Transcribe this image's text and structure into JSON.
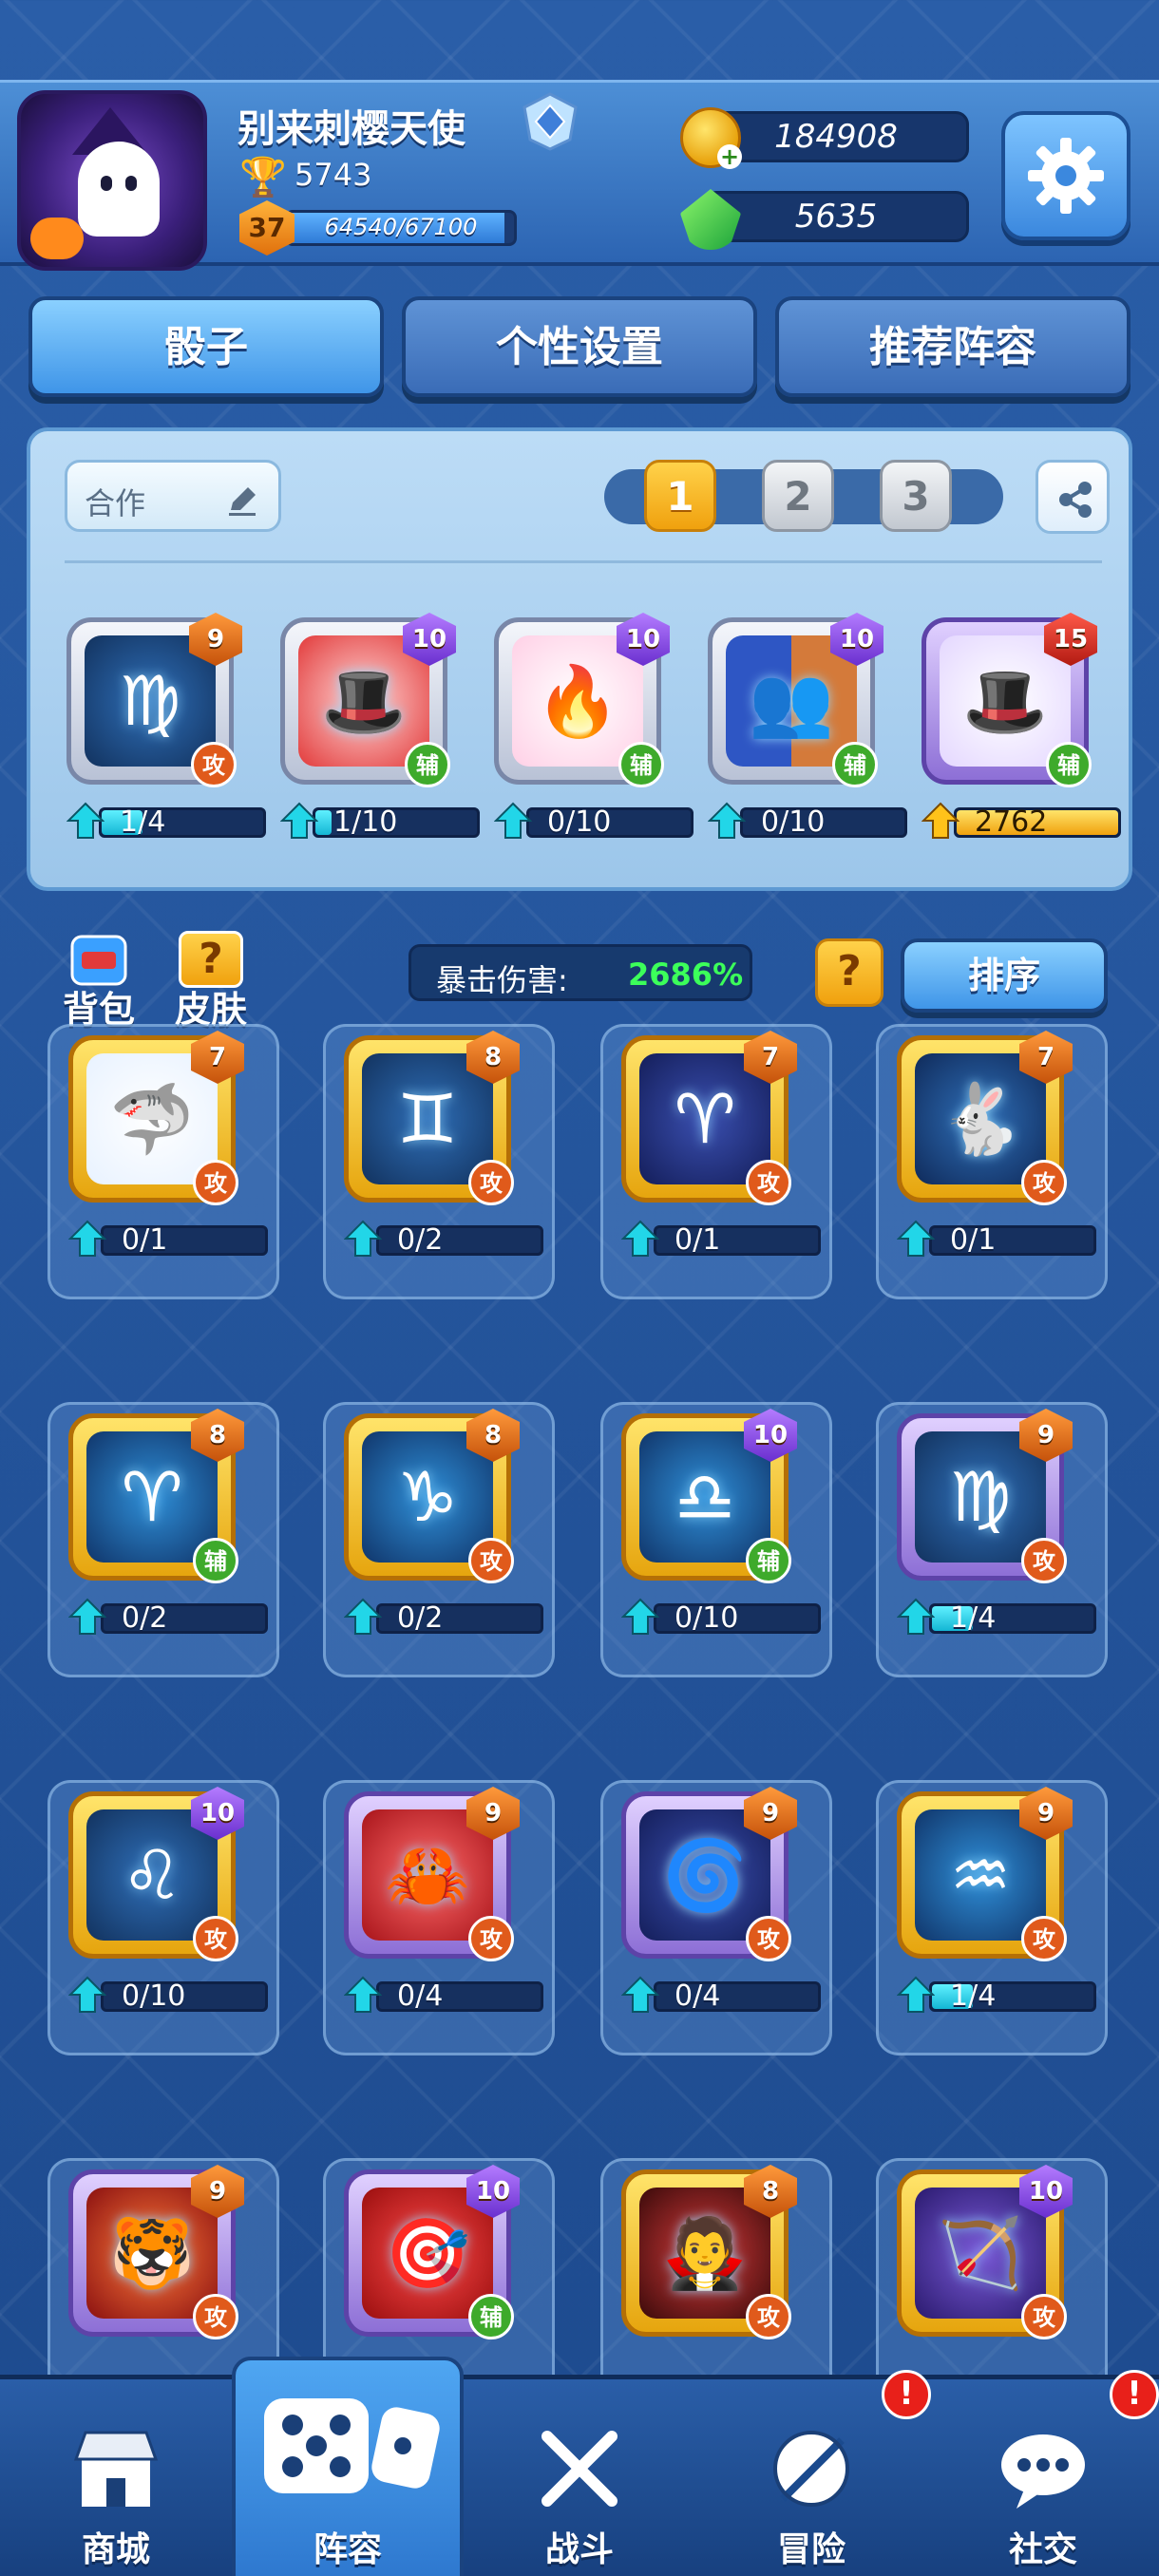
{
  "player": {
    "name": "别来刺樱天使",
    "trophies": "5743",
    "level": "37",
    "xp_text": "64540/67100"
  },
  "currency": {
    "coins": "184908",
    "gems": "5635"
  },
  "tabs": [
    {
      "label": "骰子"
    },
    {
      "label": "个性设置"
    },
    {
      "label": "推荐阵容"
    }
  ],
  "deck": {
    "name": "合作",
    "pages": [
      "1",
      "2",
      "3"
    ],
    "active_page": "1",
    "cards": [
      {
        "level": "9",
        "role": "攻",
        "progress": "1/4",
        "fill": 0.25
      },
      {
        "level": "10",
        "role": "辅",
        "progress": "1/10",
        "fill": 0.1
      },
      {
        "level": "10",
        "role": "辅",
        "progress": "0/10",
        "fill": 0
      },
      {
        "level": "10",
        "role": "辅",
        "progress": "0/10",
        "fill": 0
      },
      {
        "level": "15",
        "role": "辅",
        "progress": "2762",
        "fill": 1
      }
    ]
  },
  "toolbar": {
    "bag_label": "背包",
    "skin_label": "皮肤",
    "crit_label": "暴击伤害:",
    "crit_value": "2686%",
    "help_label": "?",
    "sort_label": "排序"
  },
  "collection": [
    {
      "level": "7",
      "role": "攻",
      "progress": "0/1",
      "fill": 0
    },
    {
      "level": "8",
      "role": "攻",
      "progress": "0/2",
      "fill": 0
    },
    {
      "level": "7",
      "role": "攻",
      "progress": "0/1",
      "fill": 0
    },
    {
      "level": "7",
      "role": "攻",
      "progress": "0/1",
      "fill": 0
    },
    {
      "level": "8",
      "role": "辅",
      "progress": "0/2",
      "fill": 0
    },
    {
      "level": "8",
      "role": "攻",
      "progress": "0/2",
      "fill": 0
    },
    {
      "level": "10",
      "role": "辅",
      "progress": "0/10",
      "fill": 0
    },
    {
      "level": "9",
      "role": "攻",
      "progress": "1/4",
      "fill": 0.25
    },
    {
      "level": "10",
      "role": "攻",
      "progress": "0/10",
      "fill": 0
    },
    {
      "level": "9",
      "role": "攻",
      "progress": "0/4",
      "fill": 0
    },
    {
      "level": "9",
      "role": "攻",
      "progress": "0/4",
      "fill": 0
    },
    {
      "level": "9",
      "role": "攻",
      "progress": "1/4",
      "fill": 0.25
    },
    {
      "level": "9",
      "role": "攻"
    },
    {
      "level": "10",
      "role": "辅"
    },
    {
      "level": "8",
      "role": "攻"
    },
    {
      "level": "10",
      "role": "攻"
    }
  ],
  "nav": [
    {
      "label": "商城"
    },
    {
      "label": "阵容"
    },
    {
      "label": "战斗"
    },
    {
      "label": "冒险",
      "badge": "!"
    },
    {
      "label": "社交",
      "badge": "!"
    }
  ]
}
